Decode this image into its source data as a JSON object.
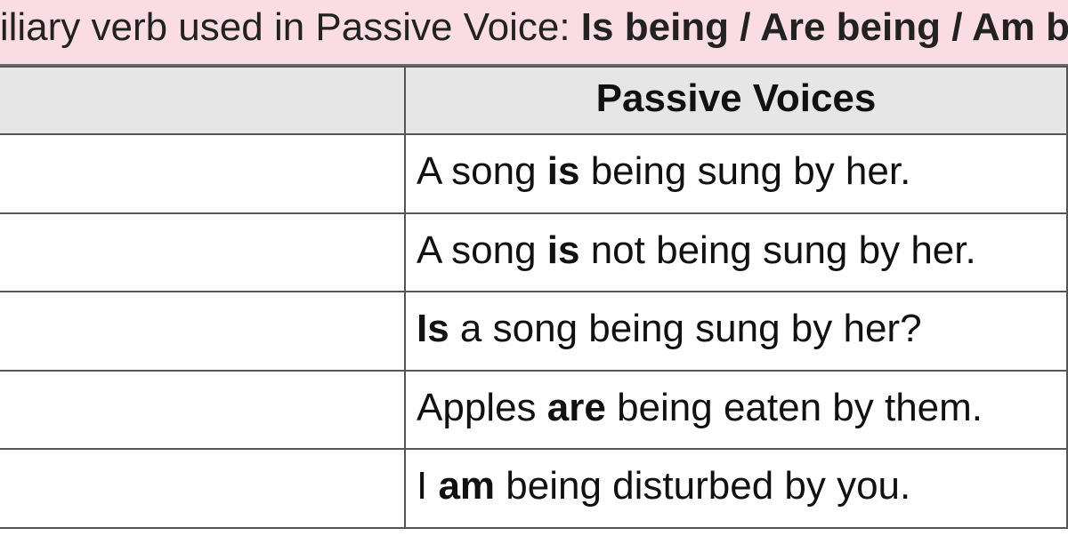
{
  "header": {
    "lead": "Auxiliary verb used in Passive Voice: ",
    "bold": "Is being / Are being / Am being"
  },
  "table": {
    "headers": {
      "left": "",
      "right": "Passive Voices"
    },
    "rows": [
      {
        "pre": "A song ",
        "bold": "is",
        "post": " being sung by her."
      },
      {
        "pre": "A song ",
        "bold": "is",
        "post": " not being sung by her."
      },
      {
        "pre": "",
        "bold": "Is",
        "post": " a song being sung by her?"
      },
      {
        "pre": "Apples ",
        "bold": "are",
        "post": " being eaten by them."
      },
      {
        "pre": "I ",
        "bold": "am",
        "post": " being disturbed by you."
      }
    ]
  }
}
